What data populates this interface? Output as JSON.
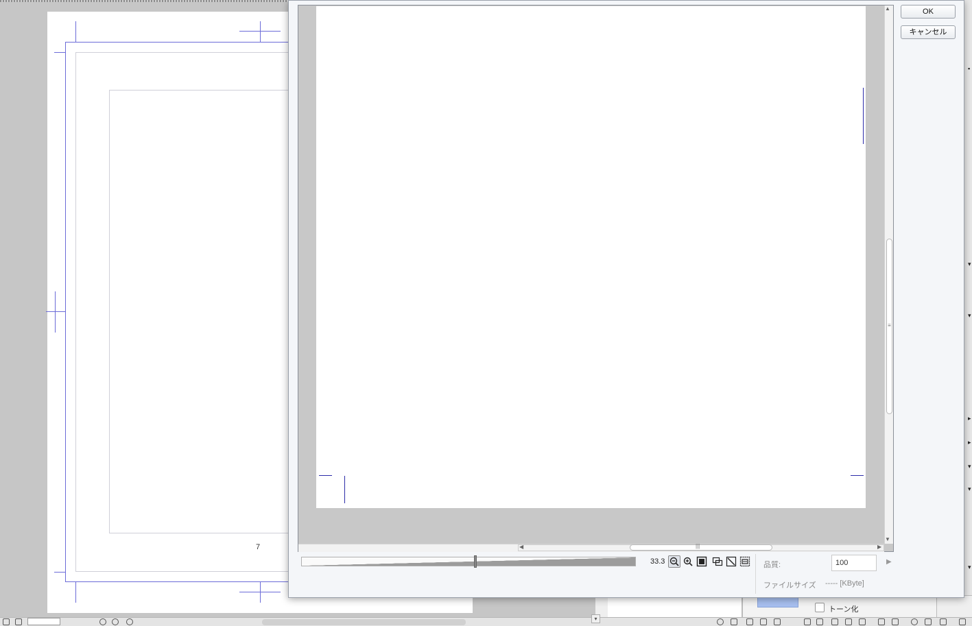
{
  "canvas": {
    "page_number": "7"
  },
  "dialog": {
    "ok_label": "OK",
    "cancel_label": "キャンセル",
    "zoom_value": "33.3",
    "quality_label": "品質:",
    "quality_value": "100",
    "filesize_label": "ファイルサイズ",
    "filesize_value": "----- [KByte]",
    "zoom_slider_position": 0.52
  },
  "toolbar_icons": [
    "zoom-out-icon",
    "zoom-in-icon",
    "actual-size-icon",
    "fit-window-icon",
    "fit-diagonal-icon",
    "print-size-icon"
  ],
  "tone_panel": {
    "tone_label": "トーン化"
  },
  "colors": {
    "guide_blue": "#6b6bd8",
    "crop_mark_blue": "#2a2aa8",
    "tone_color": "#a8c0f0"
  }
}
